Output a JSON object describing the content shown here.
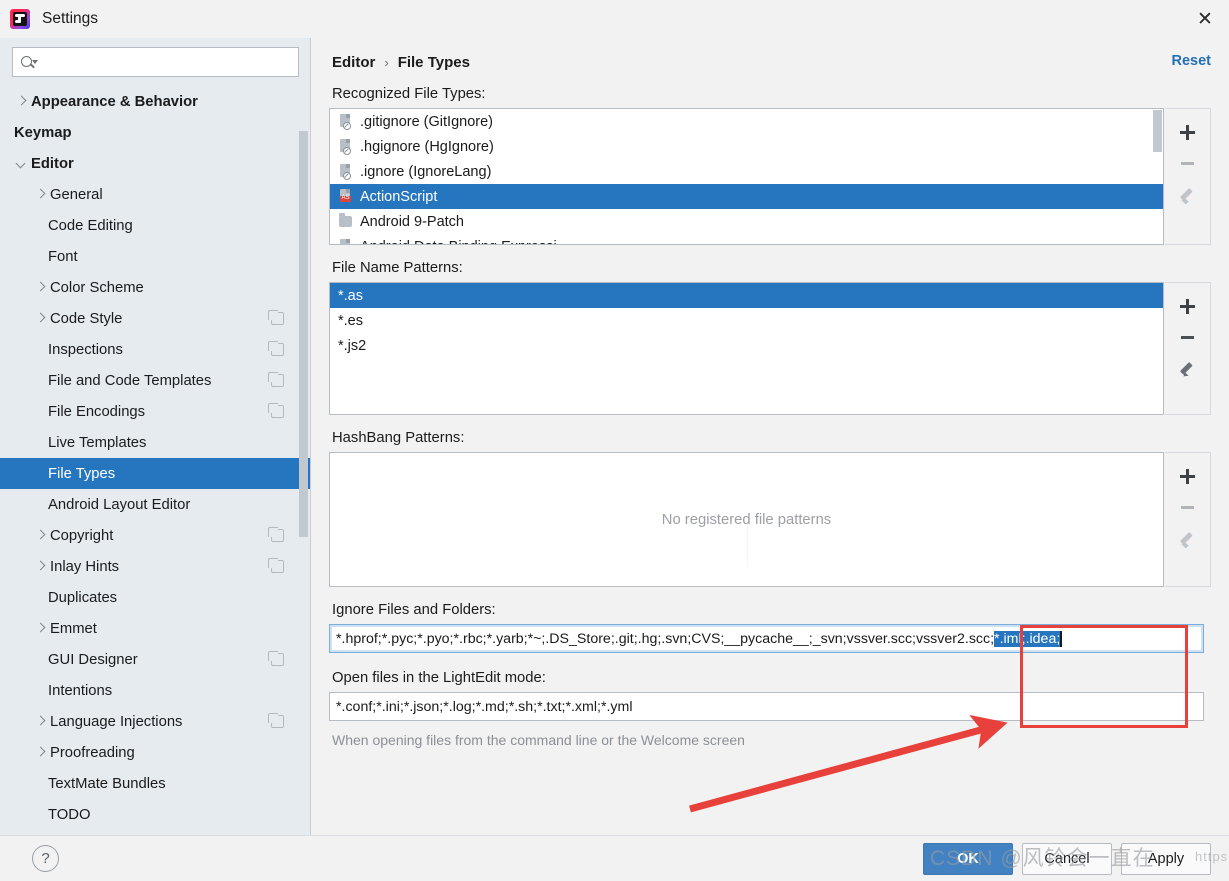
{
  "window": {
    "title": "Settings",
    "logo_icon": "intellij-idea-logo-icon",
    "close_icon": "close-icon"
  },
  "sidebar": {
    "search": {
      "value": "",
      "placeholder": "",
      "icon": "search-icon"
    },
    "items": [
      {
        "label": "Appearance & Behavior",
        "level": 0,
        "arrow": "right",
        "bold": true,
        "selected": false,
        "copy": false
      },
      {
        "label": "Keymap",
        "level": 0,
        "arrow": "none",
        "bold": true,
        "selected": false,
        "copy": false
      },
      {
        "label": "Editor",
        "level": 0,
        "arrow": "down",
        "bold": true,
        "selected": false,
        "copy": false
      },
      {
        "label": "General",
        "level": 1,
        "arrow": "right",
        "bold": false,
        "selected": false,
        "copy": false
      },
      {
        "label": "Code Editing",
        "level": 1,
        "arrow": "none",
        "bold": false,
        "selected": false,
        "copy": false
      },
      {
        "label": "Font",
        "level": 1,
        "arrow": "none",
        "bold": false,
        "selected": false,
        "copy": false
      },
      {
        "label": "Color Scheme",
        "level": 1,
        "arrow": "right",
        "bold": false,
        "selected": false,
        "copy": false
      },
      {
        "label": "Code Style",
        "level": 1,
        "arrow": "right",
        "bold": false,
        "selected": false,
        "copy": true
      },
      {
        "label": "Inspections",
        "level": 1,
        "arrow": "none",
        "bold": false,
        "selected": false,
        "copy": true
      },
      {
        "label": "File and Code Templates",
        "level": 1,
        "arrow": "none",
        "bold": false,
        "selected": false,
        "copy": true
      },
      {
        "label": "File Encodings",
        "level": 1,
        "arrow": "none",
        "bold": false,
        "selected": false,
        "copy": true
      },
      {
        "label": "Live Templates",
        "level": 1,
        "arrow": "none",
        "bold": false,
        "selected": false,
        "copy": false
      },
      {
        "label": "File Types",
        "level": 1,
        "arrow": "none",
        "bold": false,
        "selected": true,
        "copy": false
      },
      {
        "label": "Android Layout Editor",
        "level": 1,
        "arrow": "none",
        "bold": false,
        "selected": false,
        "copy": false
      },
      {
        "label": "Copyright",
        "level": 1,
        "arrow": "right",
        "bold": false,
        "selected": false,
        "copy": true
      },
      {
        "label": "Inlay Hints",
        "level": 1,
        "arrow": "right",
        "bold": false,
        "selected": false,
        "copy": true
      },
      {
        "label": "Duplicates",
        "level": 1,
        "arrow": "none",
        "bold": false,
        "selected": false,
        "copy": false
      },
      {
        "label": "Emmet",
        "level": 1,
        "arrow": "right",
        "bold": false,
        "selected": false,
        "copy": false
      },
      {
        "label": "GUI Designer",
        "level": 1,
        "arrow": "none",
        "bold": false,
        "selected": false,
        "copy": true
      },
      {
        "label": "Intentions",
        "level": 1,
        "arrow": "none",
        "bold": false,
        "selected": false,
        "copy": false
      },
      {
        "label": "Language Injections",
        "level": 1,
        "arrow": "right",
        "bold": false,
        "selected": false,
        "copy": true
      },
      {
        "label": "Proofreading",
        "level": 1,
        "arrow": "right",
        "bold": false,
        "selected": false,
        "copy": false
      },
      {
        "label": "TextMate Bundles",
        "level": 1,
        "arrow": "none",
        "bold": false,
        "selected": false,
        "copy": false
      },
      {
        "label": "TODO",
        "level": 1,
        "arrow": "none",
        "bold": false,
        "selected": false,
        "copy": false
      }
    ]
  },
  "header": {
    "breadcrumb_parent": "Editor",
    "breadcrumb_sep": "›",
    "breadcrumb_current": "File Types",
    "reset_label": "Reset"
  },
  "recognized": {
    "label": "Recognized File Types:",
    "rows": [
      {
        "text": ".gitignore (GitIgnore)",
        "icon": "ignore-file-icon",
        "selected": false
      },
      {
        "text": ".hgignore (HgIgnore)",
        "icon": "ignore-file-icon",
        "selected": false
      },
      {
        "text": ".ignore (IgnoreLang)",
        "icon": "ignore-file-icon",
        "selected": false
      },
      {
        "text": "ActionScript",
        "icon": "actionscript-file-icon",
        "selected": true
      },
      {
        "text": "Android 9-Patch",
        "icon": "folder-icon",
        "selected": false
      },
      {
        "text": "Android Data Binding Expressi",
        "icon": "file-icon",
        "selected": false
      }
    ],
    "toolbar": [
      {
        "icon": "plus-icon",
        "name": "add-file-type-button",
        "enabled": true
      },
      {
        "icon": "minus-icon",
        "name": "remove-file-type-button",
        "enabled": false
      },
      {
        "icon": "pencil-icon",
        "name": "edit-file-type-button",
        "enabled": false
      }
    ]
  },
  "patterns": {
    "label": "File Name Patterns:",
    "rows": [
      {
        "text": "*.as",
        "selected": true
      },
      {
        "text": "*.es",
        "selected": false
      },
      {
        "text": "*.js2",
        "selected": false
      }
    ],
    "toolbar": [
      {
        "icon": "plus-icon",
        "name": "add-pattern-button",
        "enabled": true
      },
      {
        "icon": "minus-icon",
        "name": "remove-pattern-button",
        "enabled": true
      },
      {
        "icon": "pencil-icon",
        "name": "edit-pattern-button",
        "enabled": true
      }
    ]
  },
  "hashbang": {
    "label": "HashBang Patterns:",
    "empty_text": "No registered file patterns",
    "toolbar": [
      {
        "icon": "plus-icon",
        "name": "add-hashbang-button",
        "enabled": true
      },
      {
        "icon": "minus-icon",
        "name": "remove-hashbang-button",
        "enabled": false
      },
      {
        "icon": "pencil-icon",
        "name": "edit-hashbang-button",
        "enabled": false
      }
    ]
  },
  "ignore_files": {
    "label": "Ignore Files and Folders:",
    "value_prefix": "*.hprof;*.pyc;*.pyo;*.rbc;*.yarb;*~;.DS_Store;.git;.hg;.svn;CVS;__pycache__;_svn;vssver.scc;vssver2.scc;",
    "value_selected": "*.iml;.idea;",
    "full_value": "*.hprof;*.pyc;*.pyo;*.rbc;*.yarb;*~;.DS_Store;.git;.hg;.svn;CVS;__pycache__;_svn;vssver.scc;vssver2.scc;*.iml;.idea;"
  },
  "lightedit": {
    "label": "Open files in the LightEdit mode:",
    "value": "*.conf;*.ini;*.json;*.log;*.md;*.sh;*.txt;*.xml;*.yml",
    "hint": "When opening files from the command line or the Welcome screen"
  },
  "footer": {
    "help_icon": "question-mark-icon",
    "ok_label": "OK",
    "cancel_label": "Cancel",
    "apply_label": "Apply"
  },
  "annotation": {
    "box_name": "red-highlight-box",
    "arrow_name": "red-pointer-arrow",
    "watermark_text": "CSDN @风铃会一直在",
    "watermark_url": "https://b"
  },
  "colors": {
    "accent_selection": "#2675bf",
    "link": "#2470b3",
    "primary_button": "#4282c3",
    "annotation_red": "#e8403a",
    "sidebar_bg": "#e6ebf0",
    "panel_bg": "#f2f2f2"
  }
}
